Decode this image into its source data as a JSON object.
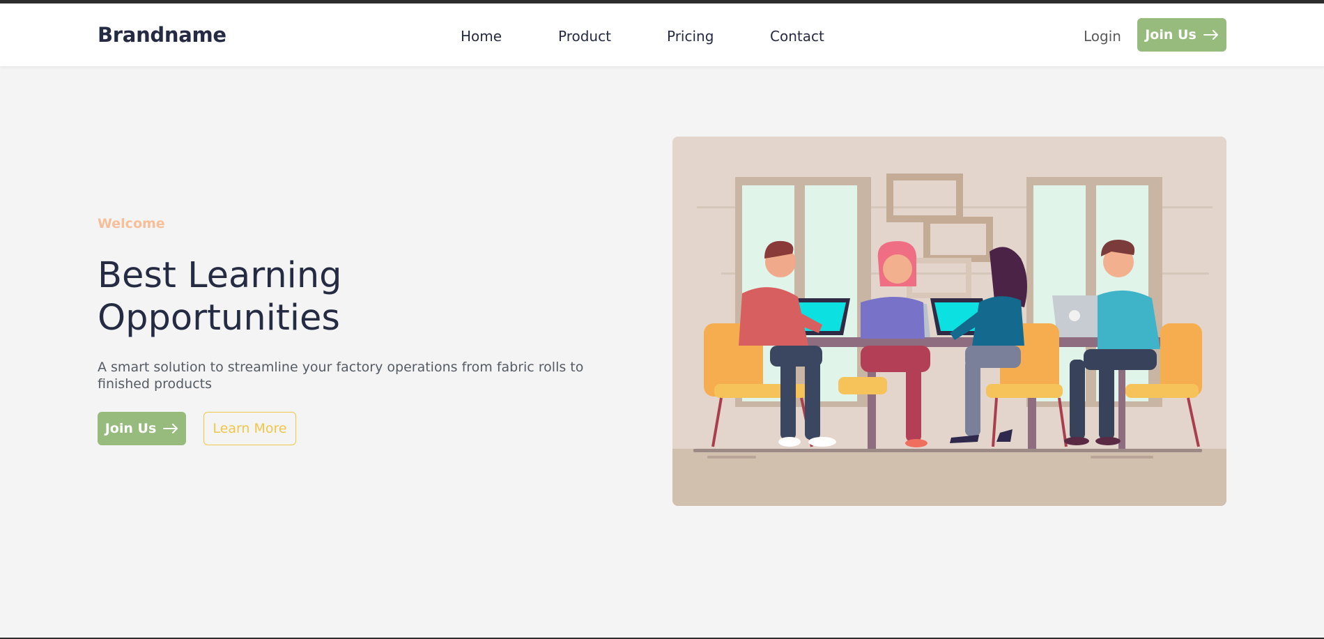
{
  "header": {
    "brand": "Brandname",
    "nav": [
      {
        "label": "Home"
      },
      {
        "label": "Product"
      },
      {
        "label": "Pricing"
      },
      {
        "label": "Contact"
      }
    ],
    "login_label": "Login",
    "join_label": "Join Us",
    "join_icon": "arrow-right-icon"
  },
  "hero": {
    "eyebrow": "Welcome",
    "title_line1": "Best Learning",
    "title_line2": "Opportunities",
    "description": "A smart solution to streamline your factory operations from fabric rolls to finished products",
    "join_label": "Join Us",
    "learn_more_label": "Learn More",
    "illustration": "team-meeting-illustration"
  },
  "colors": {
    "primary_green": "#96bb7c",
    "accent_orange": "#f6be99",
    "accent_yellow": "#f0c64a",
    "heading": "#252b42",
    "background": "#f4f4f4"
  }
}
